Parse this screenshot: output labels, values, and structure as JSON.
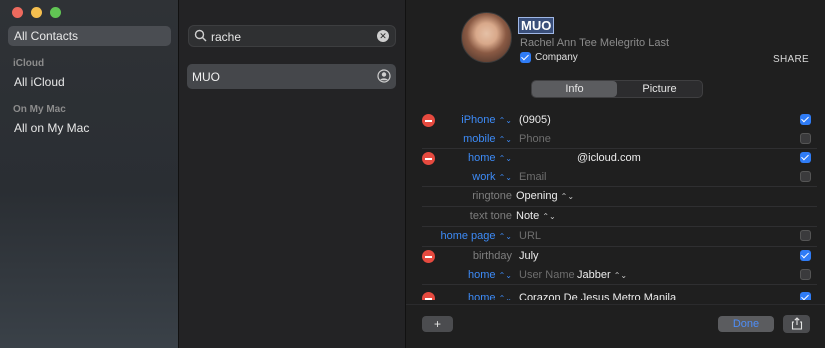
{
  "sidebar": {
    "all_contacts": "All Contacts",
    "section_icloud": "iCloud",
    "all_icloud": "All iCloud",
    "section_mac": "On My Mac",
    "all_on_mac": "All on My Mac"
  },
  "search": {
    "value": "rache"
  },
  "list": {
    "items": [
      {
        "name": "MUO"
      }
    ]
  },
  "card": {
    "nickname": "MUO",
    "full_name": "Rachel Ann Tee   Melegrito   Last",
    "company_label": "Company",
    "share_label": "SHARE",
    "tabs": [
      "Info",
      "Picture"
    ]
  },
  "fields": [
    {
      "label": "iPhone",
      "value": "(0905)",
      "removable": true,
      "checked": true
    },
    {
      "label": "mobile",
      "value": "Phone",
      "removable": false,
      "checked": false
    },
    {
      "label": "home",
      "value": "@icloud.com",
      "removable": true,
      "checked": true
    },
    {
      "label": "work",
      "value": "Email",
      "removable": false,
      "checked": false
    },
    {
      "label": "ringtone",
      "value": "Opening",
      "removable": false
    },
    {
      "label": "text tone",
      "value": "Note",
      "removable": false
    },
    {
      "label": "home page",
      "value": "URL",
      "removable": false,
      "checked": false
    },
    {
      "label": "birthday",
      "value": "July",
      "removable": true,
      "checked": true
    },
    {
      "label": "home",
      "value": "User Name",
      "extra": "Jabber",
      "removable": false,
      "checked": false
    },
    {
      "label": "home",
      "value": "Corazon De Jesus Metro Manila",
      "removable": true,
      "checked": true
    }
  ],
  "footer": {
    "add": "+",
    "done": "Done"
  },
  "colors": {
    "accent": "#2f7cf6",
    "remove": "#e64a3f",
    "label_blue": "#3d8bf7"
  }
}
